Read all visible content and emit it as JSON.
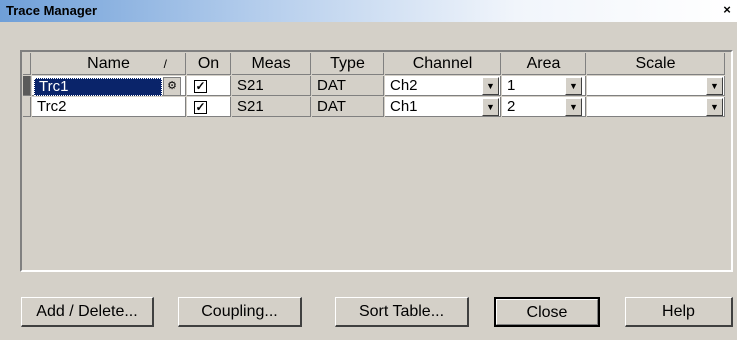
{
  "window": {
    "title": "Trace Manager",
    "close_glyph": "×"
  },
  "table": {
    "headers": {
      "name": "Name",
      "name_sort": "/",
      "on": "On",
      "meas": "Meas",
      "type": "Type",
      "channel": "Channel",
      "area": "Area",
      "scale": "Scale"
    },
    "rows": [
      {
        "name": "Trc1",
        "on": true,
        "meas": "S21",
        "type": "DAT",
        "channel": "Ch2",
        "area": "1",
        "scale": ""
      },
      {
        "name": "Trc2",
        "on": true,
        "meas": "S21",
        "type": "DAT",
        "channel": "Ch1",
        "area": "2",
        "scale": ""
      }
    ],
    "checkmark": "✓",
    "dropdown_glyph": "▼",
    "name_button_glyph": "⚙"
  },
  "buttons": {
    "add_delete": "Add / Delete...",
    "coupling": "Coupling...",
    "sort_table": "Sort Table...",
    "close": "Close",
    "help": "Help"
  }
}
